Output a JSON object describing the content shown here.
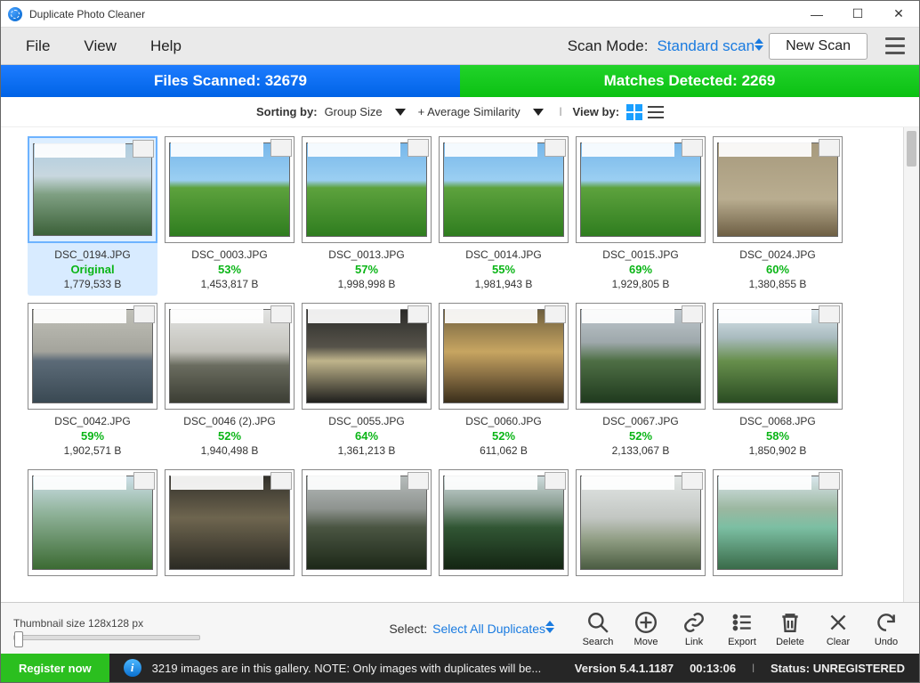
{
  "title": "Duplicate Photo Cleaner",
  "menu": {
    "file": "File",
    "view": "View",
    "help": "Help"
  },
  "scan": {
    "mode_label": "Scan Mode:",
    "mode_value": "Standard scan",
    "new_scan": "New Scan"
  },
  "bands": {
    "scanned_label": "Files Scanned:",
    "scanned_value": "32679",
    "matches_label": "Matches Detected:",
    "matches_value": "2269"
  },
  "sortbar": {
    "sorting_by": "Sorting by:",
    "primary": "Group Size",
    "secondary": "+ Average Similarity",
    "view_by": "View by:"
  },
  "thumb_size_label": "Thumbnail size 128x128 px",
  "select": {
    "label": "Select:",
    "link": "Select All Duplicates"
  },
  "actions": {
    "search": "Search",
    "move": "Move",
    "link": "Link",
    "export": "Export",
    "delete": "Delete",
    "clear": "Clear",
    "undo": "Undo"
  },
  "status": {
    "register": "Register now",
    "message": "3219 images are in this gallery. NOTE: Only images with duplicates will be...",
    "version": "Version 5.4.1.1187",
    "time": "00:13:06",
    "status_label": "Status:",
    "status_value": "UNREGISTERED"
  },
  "cards": [
    {
      "file": "DSC_0194.JPG",
      "sim": "Original",
      "size": "1,779,533 B",
      "bg": "bg-sky",
      "selected": true
    },
    {
      "file": "DSC_0003.JPG",
      "sim": "53%",
      "size": "1,453,817 B",
      "bg": "bg-field"
    },
    {
      "file": "DSC_0013.JPG",
      "sim": "57%",
      "size": "1,998,998 B",
      "bg": "bg-field"
    },
    {
      "file": "DSC_0014.JPG",
      "sim": "55%",
      "size": "1,981,943 B",
      "bg": "bg-field"
    },
    {
      "file": "DSC_0015.JPG",
      "sim": "69%",
      "size": "1,929,805 B",
      "bg": "bg-field"
    },
    {
      "file": "DSC_0024.JPG",
      "sim": "60%",
      "size": "1,380,855 B",
      "bg": "bg-room"
    },
    {
      "file": "DSC_0042.JPG",
      "sim": "59%",
      "size": "1,902,571 B",
      "bg": "bg-sea"
    },
    {
      "file": "DSC_0046 (2).JPG",
      "sim": "52%",
      "size": "1,940,498 B",
      "bg": "bg-city"
    },
    {
      "file": "DSC_0055.JPG",
      "sim": "64%",
      "size": "1,361,213 B",
      "bg": "bg-storm"
    },
    {
      "file": "DSC_0060.JPG",
      "sim": "52%",
      "size": "611,062 B",
      "bg": "bg-cloud"
    },
    {
      "file": "DSC_0067.JPG",
      "sim": "52%",
      "size": "2,133,067 B",
      "bg": "bg-hill"
    },
    {
      "file": "DSC_0068.JPG",
      "sim": "58%",
      "size": "1,850,902 B",
      "bg": "bg-terrace"
    },
    {
      "file": "",
      "sim": "",
      "size": "",
      "bg": "bg-green",
      "partial": true
    },
    {
      "file": "",
      "sim": "",
      "size": "",
      "bg": "bg-sunset",
      "partial": true
    },
    {
      "file": "",
      "sim": "",
      "size": "",
      "bg": "bg-pano",
      "partial": true
    },
    {
      "file": "",
      "sim": "",
      "size": "",
      "bg": "bg-trees",
      "partial": true
    },
    {
      "file": "",
      "sim": "",
      "size": "",
      "bg": "bg-fog",
      "partial": true
    },
    {
      "file": "",
      "sim": "",
      "size": "",
      "bg": "bg-lake",
      "partial": true
    }
  ]
}
